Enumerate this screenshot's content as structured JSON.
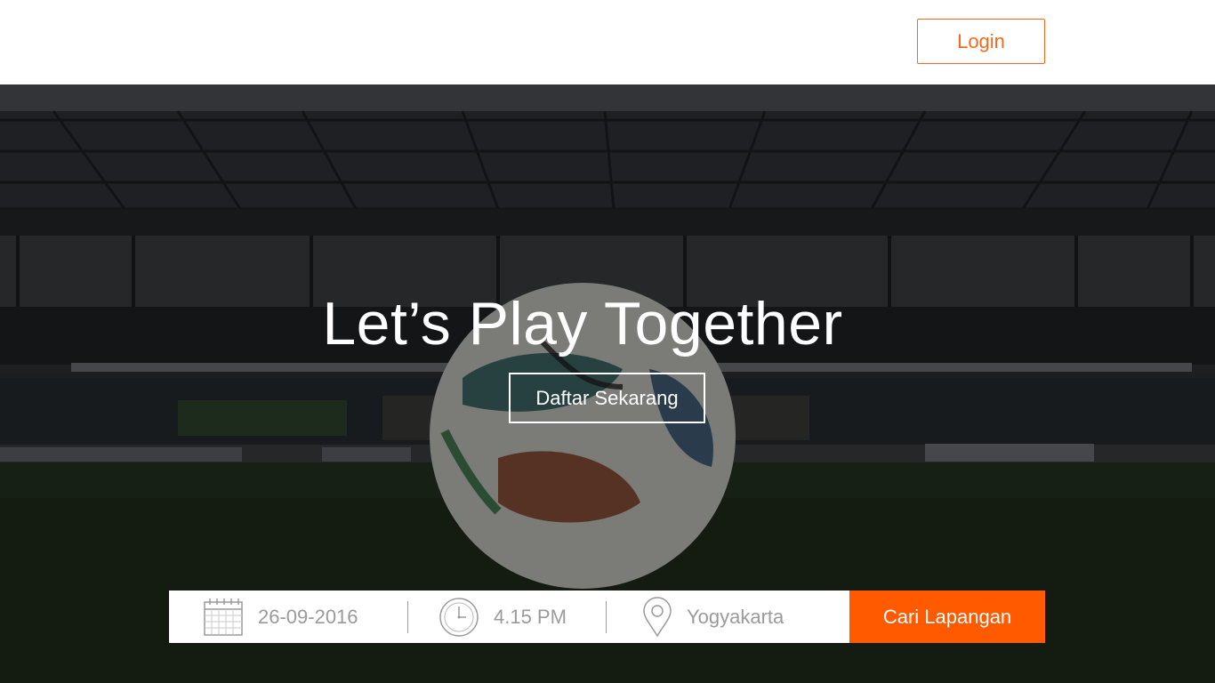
{
  "header": {
    "login_label": "Login"
  },
  "hero": {
    "title": "Let’s Play Together",
    "signup_label": "Daftar Sekarang"
  },
  "search": {
    "date_value": "26-09-2016",
    "time_value": "4.15 PM",
    "location_value": "Yogyakarta",
    "button_label": "Cari Lapangan"
  },
  "colors": {
    "accent": "#ff5a00",
    "login_border": "#f26b1d",
    "field_text": "#9a9a9a"
  },
  "icons": {
    "date": "calendar-icon",
    "time": "clock-icon",
    "location": "map-pin-icon"
  }
}
